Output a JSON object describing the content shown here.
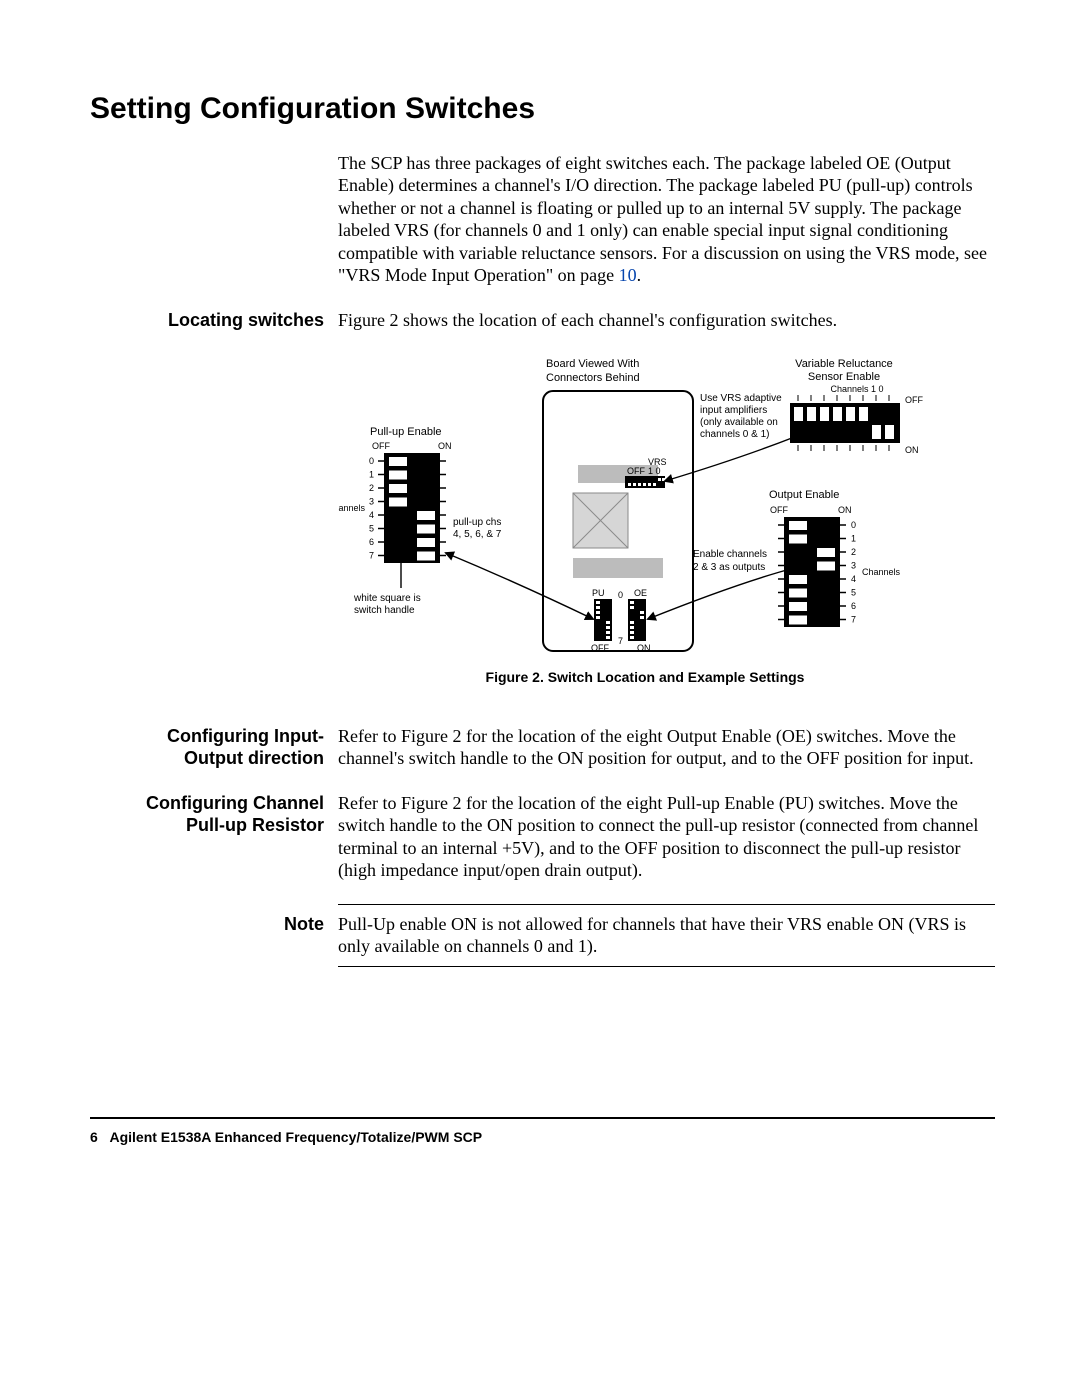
{
  "title": "Setting Configuration Switches",
  "intro": "The SCP has three packages of eight switches each. The package labeled OE (Output Enable) determines a channel's I/O direction. The package labeled PU (pull-up) controls whether or not a channel is floating or pulled up to an internal 5V supply. The package labeled VRS (for channels 0 and 1 only) can enable special input signal conditioning compatible with variable reluctance sensors. For a discussion on using the VRS mode, see \"VRS Mode Input Operation\" on page ",
  "intro_link": "10",
  "intro_tail": ".",
  "locating_label": "Locating switches",
  "locating_body": "Figure 2 shows the location of each channel's configuration switches.",
  "figure_caption": "Figure 2. Switch Location and Example Settings",
  "io_label_a": "Configuring Input-",
  "io_label_b": "Output direction",
  "io_body": "Refer to Figure 2 for the location of the eight Output Enable (OE) switches. Move the channel's switch handle to the ON position for output, and to the OFF position for input.",
  "pu_label_a": "Configuring Channel",
  "pu_label_b": "Pull-up Resistor",
  "pu_body": "Refer to Figure 2 for the location of the eight Pull-up Enable (PU) switches. Move the switch handle to the ON position to connect the pull-up resistor (connected from channel terminal to an internal +5V), and to the OFF position to disconnect the pull-up resistor (high impedance input/open drain output).",
  "note_label": "Note",
  "note_body": "Pull-Up enable ON is not allowed for channels that have their VRS enable ON (VRS is only available on channels 0 and 1).",
  "footer_page": "6",
  "footer_text": "Agilent E1538A Enhanced Frequency/Totalize/PWM SCP",
  "fig": {
    "board_viewed": "Board Viewed With",
    "connectors_behind": "Connectors Behind",
    "vrs_title": "Variable Reluctance",
    "vrs_title2": "Sensor Enable",
    "channels_10": "Channels 1 0",
    "off": "OFF",
    "on": "ON",
    "use_vrs_1": "Use VRS adaptive",
    "use_vrs_2": "input amplifiers",
    "use_vrs_3": "(only available on",
    "use_vrs_4": "channels 0 & 1)",
    "output_enable": "Output Enable",
    "channels": "Channels",
    "enable_1": "Enable channels",
    "enable_2": "2 & 3 as outputs",
    "pullup_enable": "Pull-up Enable",
    "pullup_chs1": "pull-up chs",
    "pullup_chs2": "4, 5, 6, & 7",
    "white1": "white square is",
    "white2": "switch handle",
    "vrs": "VRS",
    "pu": "PU",
    "oe": "OE",
    "d0": "0",
    "d1": "1",
    "d2": "2",
    "d3": "3",
    "d4": "4",
    "d5": "5",
    "d6": "6",
    "d7": "7"
  }
}
